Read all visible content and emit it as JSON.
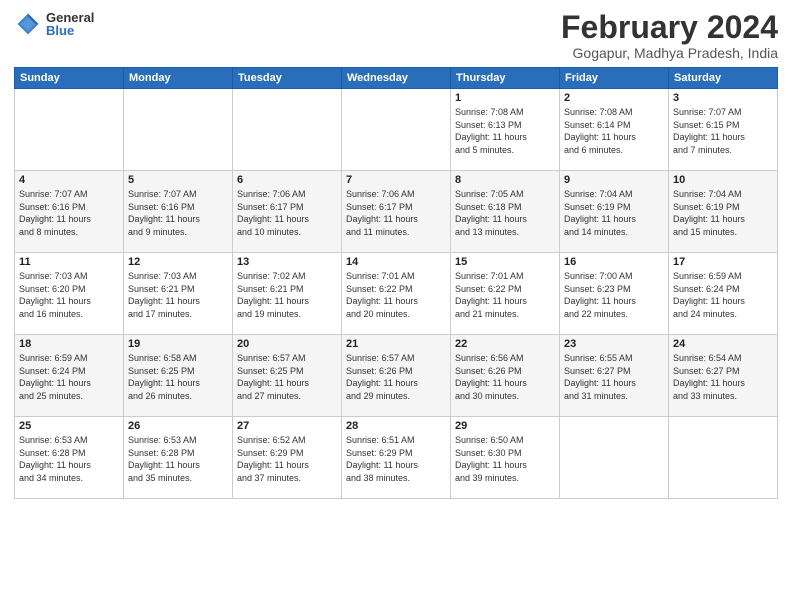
{
  "header": {
    "logo": {
      "general": "General",
      "blue": "Blue"
    },
    "title": "February 2024",
    "location": "Gogapur, Madhya Pradesh, India"
  },
  "days_of_week": [
    "Sunday",
    "Monday",
    "Tuesday",
    "Wednesday",
    "Thursday",
    "Friday",
    "Saturday"
  ],
  "weeks": [
    [
      {
        "day": "",
        "info": ""
      },
      {
        "day": "",
        "info": ""
      },
      {
        "day": "",
        "info": ""
      },
      {
        "day": "",
        "info": ""
      },
      {
        "day": "1",
        "info": "Sunrise: 7:08 AM\nSunset: 6:13 PM\nDaylight: 11 hours\nand 5 minutes."
      },
      {
        "day": "2",
        "info": "Sunrise: 7:08 AM\nSunset: 6:14 PM\nDaylight: 11 hours\nand 6 minutes."
      },
      {
        "day": "3",
        "info": "Sunrise: 7:07 AM\nSunset: 6:15 PM\nDaylight: 11 hours\nand 7 minutes."
      }
    ],
    [
      {
        "day": "4",
        "info": "Sunrise: 7:07 AM\nSunset: 6:16 PM\nDaylight: 11 hours\nand 8 minutes."
      },
      {
        "day": "5",
        "info": "Sunrise: 7:07 AM\nSunset: 6:16 PM\nDaylight: 11 hours\nand 9 minutes."
      },
      {
        "day": "6",
        "info": "Sunrise: 7:06 AM\nSunset: 6:17 PM\nDaylight: 11 hours\nand 10 minutes."
      },
      {
        "day": "7",
        "info": "Sunrise: 7:06 AM\nSunset: 6:17 PM\nDaylight: 11 hours\nand 11 minutes."
      },
      {
        "day": "8",
        "info": "Sunrise: 7:05 AM\nSunset: 6:18 PM\nDaylight: 11 hours\nand 13 minutes."
      },
      {
        "day": "9",
        "info": "Sunrise: 7:04 AM\nSunset: 6:19 PM\nDaylight: 11 hours\nand 14 minutes."
      },
      {
        "day": "10",
        "info": "Sunrise: 7:04 AM\nSunset: 6:19 PM\nDaylight: 11 hours\nand 15 minutes."
      }
    ],
    [
      {
        "day": "11",
        "info": "Sunrise: 7:03 AM\nSunset: 6:20 PM\nDaylight: 11 hours\nand 16 minutes."
      },
      {
        "day": "12",
        "info": "Sunrise: 7:03 AM\nSunset: 6:21 PM\nDaylight: 11 hours\nand 17 minutes."
      },
      {
        "day": "13",
        "info": "Sunrise: 7:02 AM\nSunset: 6:21 PM\nDaylight: 11 hours\nand 19 minutes."
      },
      {
        "day": "14",
        "info": "Sunrise: 7:01 AM\nSunset: 6:22 PM\nDaylight: 11 hours\nand 20 minutes."
      },
      {
        "day": "15",
        "info": "Sunrise: 7:01 AM\nSunset: 6:22 PM\nDaylight: 11 hours\nand 21 minutes."
      },
      {
        "day": "16",
        "info": "Sunrise: 7:00 AM\nSunset: 6:23 PM\nDaylight: 11 hours\nand 22 minutes."
      },
      {
        "day": "17",
        "info": "Sunrise: 6:59 AM\nSunset: 6:24 PM\nDaylight: 11 hours\nand 24 minutes."
      }
    ],
    [
      {
        "day": "18",
        "info": "Sunrise: 6:59 AM\nSunset: 6:24 PM\nDaylight: 11 hours\nand 25 minutes."
      },
      {
        "day": "19",
        "info": "Sunrise: 6:58 AM\nSunset: 6:25 PM\nDaylight: 11 hours\nand 26 minutes."
      },
      {
        "day": "20",
        "info": "Sunrise: 6:57 AM\nSunset: 6:25 PM\nDaylight: 11 hours\nand 27 minutes."
      },
      {
        "day": "21",
        "info": "Sunrise: 6:57 AM\nSunset: 6:26 PM\nDaylight: 11 hours\nand 29 minutes."
      },
      {
        "day": "22",
        "info": "Sunrise: 6:56 AM\nSunset: 6:26 PM\nDaylight: 11 hours\nand 30 minutes."
      },
      {
        "day": "23",
        "info": "Sunrise: 6:55 AM\nSunset: 6:27 PM\nDaylight: 11 hours\nand 31 minutes."
      },
      {
        "day": "24",
        "info": "Sunrise: 6:54 AM\nSunset: 6:27 PM\nDaylight: 11 hours\nand 33 minutes."
      }
    ],
    [
      {
        "day": "25",
        "info": "Sunrise: 6:53 AM\nSunset: 6:28 PM\nDaylight: 11 hours\nand 34 minutes."
      },
      {
        "day": "26",
        "info": "Sunrise: 6:53 AM\nSunset: 6:28 PM\nDaylight: 11 hours\nand 35 minutes."
      },
      {
        "day": "27",
        "info": "Sunrise: 6:52 AM\nSunset: 6:29 PM\nDaylight: 11 hours\nand 37 minutes."
      },
      {
        "day": "28",
        "info": "Sunrise: 6:51 AM\nSunset: 6:29 PM\nDaylight: 11 hours\nand 38 minutes."
      },
      {
        "day": "29",
        "info": "Sunrise: 6:50 AM\nSunset: 6:30 PM\nDaylight: 11 hours\nand 39 minutes."
      },
      {
        "day": "",
        "info": ""
      },
      {
        "day": "",
        "info": ""
      }
    ]
  ]
}
